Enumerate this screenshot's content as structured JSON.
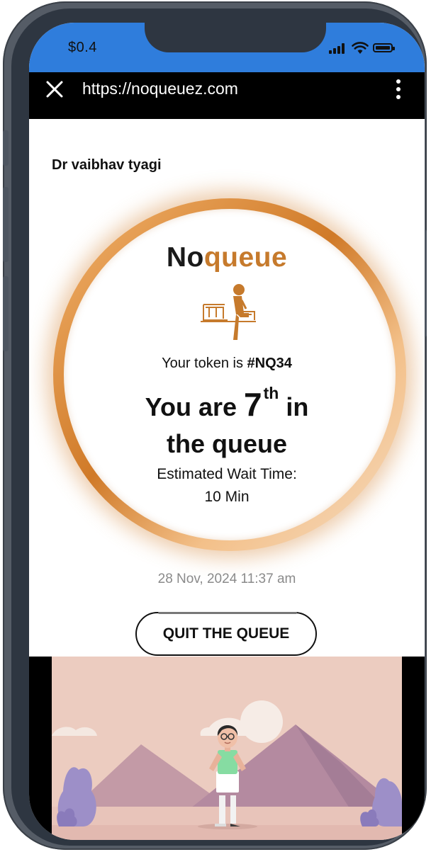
{
  "status_bar": {
    "time": "$0.4",
    "signal_icon": "signal-bars-icon",
    "wifi_icon": "wifi-icon",
    "battery_icon": "battery-icon",
    "color": "#2f7ddc"
  },
  "browser": {
    "close_icon": "close-icon",
    "url": "https://noqueuez.com",
    "menu_icon": "more-vert-icon"
  },
  "page": {
    "doctor_name": "Dr vaibhav tyagi",
    "brand": {
      "part1": "No",
      "part2": "queue",
      "accent": "#c67a2c"
    },
    "bench_icon": "person-on-bench-icon",
    "token_prefix": "Your token is",
    "token": "#NQ34",
    "position_prefix": "You are",
    "position_number": "7",
    "position_suffix": "th",
    "position_after": "in",
    "queue_line": "the queue",
    "wait_label": "Estimated Wait Time:",
    "wait_value": "10 Min",
    "timestamp": "28 Nov, 2024 11:37 am",
    "quit_button": "QUIT THE QUEUE"
  }
}
